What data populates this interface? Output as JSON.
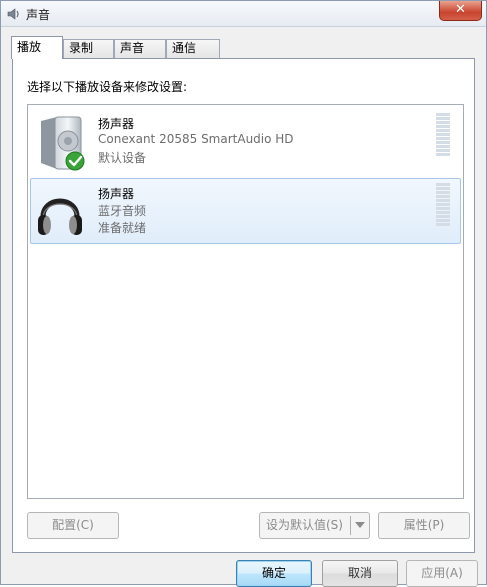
{
  "window": {
    "title": "声音",
    "close_label": "✕"
  },
  "tabs": [
    {
      "label": "播放",
      "active": true
    },
    {
      "label": "录制",
      "active": false
    },
    {
      "label": "声音",
      "active": false
    },
    {
      "label": "通信",
      "active": false
    }
  ],
  "panel": {
    "instruction": "选择以下播放设备来修改设置:"
  },
  "devices": [
    {
      "name": "扬声器",
      "line1": "Conexant 20585 SmartAudio HD",
      "line2": "默认设备",
      "icon": "speaker-icon",
      "default_check": true,
      "selected": false
    },
    {
      "name": "扬声器",
      "line1": "蓝牙音频",
      "line2": "准备就绪",
      "icon": "headphones-icon",
      "default_check": false,
      "selected": true
    }
  ],
  "panel_buttons": {
    "configure": "配置(C)",
    "set_default": "设为默认值(S)",
    "properties": "属性(P)"
  },
  "dialog_buttons": {
    "ok": "确定",
    "cancel": "取消",
    "apply": "应用(A)"
  },
  "colors": {
    "selection": "#e0edfa",
    "check_green": "#3aa33a",
    "close_red": "#c8442e"
  }
}
